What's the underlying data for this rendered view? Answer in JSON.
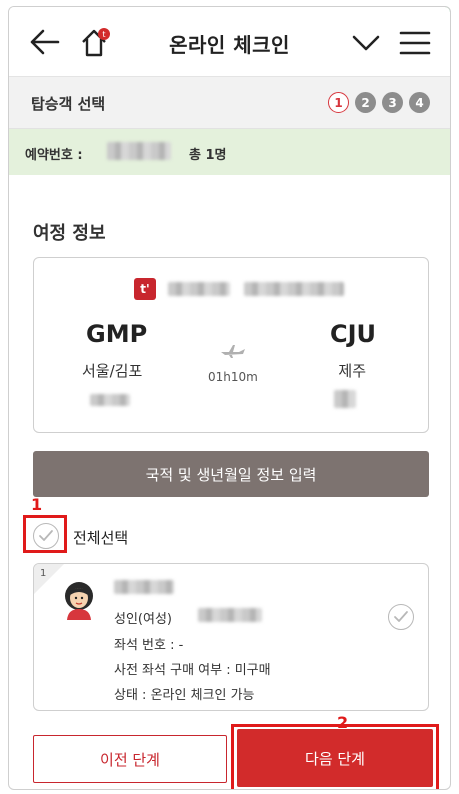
{
  "header": {
    "title": "온라인 체크인"
  },
  "step_bar": {
    "title": "탑승객 선택",
    "steps": [
      "1",
      "2",
      "3",
      "4"
    ],
    "current_step": 1
  },
  "booking": {
    "label": "예약번호 :",
    "count": "총 1명"
  },
  "itinerary": {
    "section_title": "여정 정보",
    "airline_logo_glyph": "t'",
    "departure": {
      "code": "GMP",
      "city": "서울/김포"
    },
    "arrival": {
      "code": "CJU",
      "city": "제주"
    },
    "duration": "01h10m"
  },
  "info_button": {
    "label": "국적 및 생년월일 정보 입력"
  },
  "annotations": {
    "marker1": "1",
    "marker2": "2"
  },
  "select_all": {
    "label": "전체선택",
    "checked": false
  },
  "passenger": {
    "number": "1",
    "type": "성인(여성)",
    "seat": "좌석 번호 : -",
    "prepurchase": "사전 좌석 구매 여부 : 미구매",
    "status": "상태 : 온라인 체크인 가능",
    "checked": false
  },
  "buttons": {
    "prev": "이전 단계",
    "next": "다음 단계"
  },
  "colors": {
    "brand_red": "#c8262e",
    "info_button_bg": "#7d7370",
    "booking_bar_bg": "#e4f1dc",
    "highlight_red": "#e01a1a"
  }
}
